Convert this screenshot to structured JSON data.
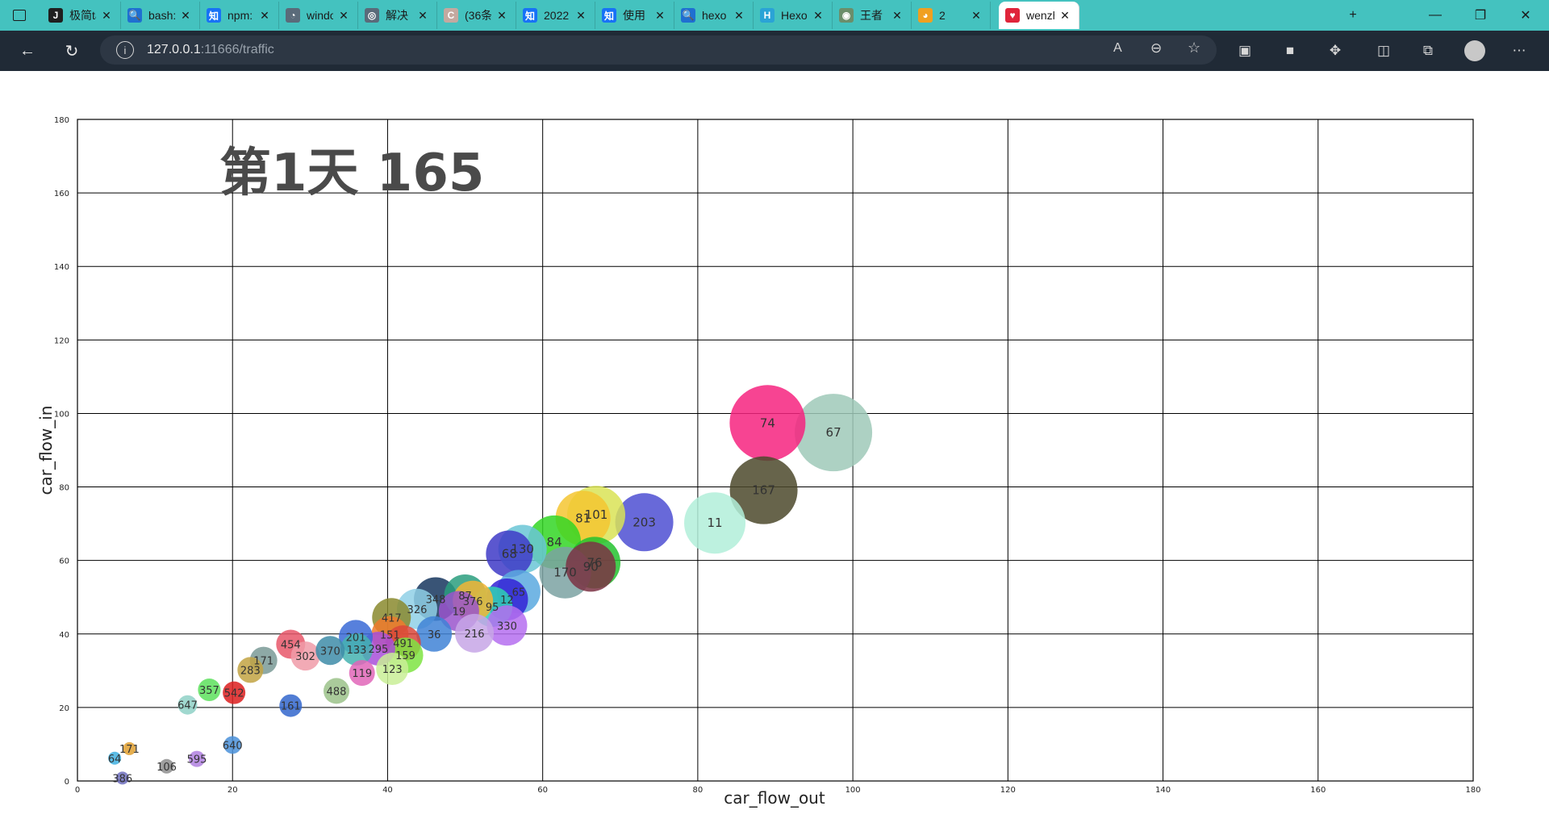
{
  "browser": {
    "tabs": [
      {
        "title": "极简ta",
        "icon": "j-icon",
        "glyph": "J",
        "color": "#1f1f1f",
        "active": false
      },
      {
        "title": "bash:",
        "icon": "search-icon",
        "glyph": "🔍",
        "color": "#1f6fd1",
        "active": false
      },
      {
        "title": "npm:",
        "icon": "zhihu-icon",
        "glyph": "知",
        "color": "#1772f6",
        "active": false
      },
      {
        "title": "windo",
        "icon": "site-icon",
        "glyph": "◔",
        "color": "#5a6b7a",
        "active": false
      },
      {
        "title": "解决 E",
        "icon": "site-icon",
        "glyph": "◎",
        "color": "#5a6b7a",
        "active": false
      },
      {
        "title": "(36条",
        "icon": "csdn-icon",
        "glyph": "C",
        "color": "#c4a9a0",
        "active": false
      },
      {
        "title": "2022",
        "icon": "zhihu-icon",
        "glyph": "知",
        "color": "#1772f6",
        "active": false
      },
      {
        "title": "使用",
        "icon": "zhihu-icon",
        "glyph": "知",
        "color": "#1772f6",
        "active": false
      },
      {
        "title": "hexo",
        "icon": "search-icon",
        "glyph": "🔍",
        "color": "#1f6fd1",
        "active": false
      },
      {
        "title": "Hexo",
        "icon": "hexo-icon",
        "glyph": "H",
        "color": "#2aa3d6",
        "active": false
      },
      {
        "title": "王者",
        "icon": "site-icon",
        "glyph": "◉",
        "color": "#6b8e6b",
        "active": false
      },
      {
        "title": "2",
        "icon": "audio-icon",
        "glyph": "◕",
        "color": "#f0a020",
        "active": false
      },
      {
        "title": "wenzh",
        "icon": "heart-icon",
        "glyph": "♥",
        "color": "#e0243a",
        "active": true
      }
    ],
    "new_tab_label": "+",
    "url_host": "127.0.0.1",
    "url_rest": ":11666/traffic"
  },
  "chart_data": {
    "type": "scatter",
    "title": "第1天 165",
    "xlabel": "car_flow_out",
    "ylabel": "car_flow_in",
    "xlim": [
      0,
      180
    ],
    "ylim": [
      0,
      180
    ],
    "xticks": [
      0,
      20,
      40,
      60,
      80,
      100,
      120,
      140,
      160,
      180
    ],
    "yticks": [
      0,
      20,
      40,
      60,
      80,
      100,
      120,
      140,
      160,
      180
    ],
    "grid": true,
    "points": [
      {
        "label": "67",
        "x": 97.5,
        "y": 94.8,
        "r": 48,
        "color": "#9fc9b9"
      },
      {
        "label": "74",
        "x": 89.0,
        "y": 97.4,
        "r": 47,
        "color": "#f6237f"
      },
      {
        "label": "167",
        "x": 88.5,
        "y": 79.1,
        "r": 42,
        "color": "#4c492b"
      },
      {
        "label": "11",
        "x": 82.2,
        "y": 70.2,
        "r": 38,
        "color": "#b1efd9"
      },
      {
        "label": "203",
        "x": 73.1,
        "y": 70.4,
        "r": 36,
        "color": "#4d4fd2"
      },
      {
        "label": "101",
        "x": 66.9,
        "y": 72.4,
        "r": 36,
        "color": "#d9e356"
      },
      {
        "label": "81",
        "x": 65.2,
        "y": 71.5,
        "r": 34,
        "color": "#f5c531"
      },
      {
        "label": "84",
        "x": 61.5,
        "y": 65.0,
        "r": 33,
        "color": "#33d624"
      },
      {
        "label": "76",
        "x": 66.7,
        "y": 59.4,
        "r": 32,
        "color": "#23c22f"
      },
      {
        "label": "90",
        "x": 66.2,
        "y": 58.3,
        "r": 31,
        "color": "#7b3244"
      },
      {
        "label": "170",
        "x": 62.9,
        "y": 56.7,
        "r": 32,
        "color": "#7ba2a2"
      },
      {
        "label": "130",
        "x": 57.4,
        "y": 63.1,
        "r": 30,
        "color": "#6ac6d6"
      },
      {
        "label": "68",
        "x": 55.7,
        "y": 61.8,
        "r": 29,
        "color": "#3e3ac7"
      },
      {
        "label": "65",
        "x": 56.9,
        "y": 51.5,
        "r": 27,
        "color": "#5aa9df"
      },
      {
        "label": "12",
        "x": 55.4,
        "y": 49.4,
        "r": 26,
        "color": "#3322d6"
      },
      {
        "label": "95",
        "x": 53.5,
        "y": 47.4,
        "r": 25,
        "color": "#2fd1b4"
      },
      {
        "label": "330",
        "x": 55.4,
        "y": 42.3,
        "r": 25,
        "color": "#b56ef0"
      },
      {
        "label": "216",
        "x": 51.2,
        "y": 40.2,
        "r": 24,
        "color": "#c7a6e6"
      },
      {
        "label": "376",
        "x": 51.0,
        "y": 49.0,
        "r": 25,
        "color": "#f2b535"
      },
      {
        "label": "87",
        "x": 50.0,
        "y": 50.5,
        "r": 26,
        "color": "#2a9e7e"
      },
      {
        "label": "19",
        "x": 49.2,
        "y": 46.2,
        "r": 25,
        "color": "#9a55cc"
      },
      {
        "label": "348",
        "x": 46.2,
        "y": 49.5,
        "r": 27,
        "color": "#16365e"
      },
      {
        "label": "36",
        "x": 46.0,
        "y": 40.0,
        "r": 22,
        "color": "#3f83d6"
      },
      {
        "label": "326",
        "x": 43.8,
        "y": 46.8,
        "r": 25,
        "color": "#8fd0e6"
      },
      {
        "label": "417",
        "x": 40.5,
        "y": 44.5,
        "r": 24,
        "color": "#8a8a2e"
      },
      {
        "label": "151",
        "x": 40.3,
        "y": 39.8,
        "r": 23,
        "color": "#ee7a2d"
      },
      {
        "label": "491",
        "x": 42.0,
        "y": 37.5,
        "r": 22,
        "color": "#d9463a"
      },
      {
        "label": "159",
        "x": 42.3,
        "y": 34.2,
        "r": 22,
        "color": "#7ee442"
      },
      {
        "label": "123",
        "x": 40.6,
        "y": 30.5,
        "r": 20,
        "color": "#c9ef96"
      },
      {
        "label": "295",
        "x": 38.8,
        "y": 36.0,
        "r": 21,
        "color": "#a84fd9"
      },
      {
        "label": "201",
        "x": 35.9,
        "y": 39.2,
        "r": 21,
        "color": "#3a6ad6"
      },
      {
        "label": "133",
        "x": 36.0,
        "y": 35.8,
        "r": 20,
        "color": "#45b3b0"
      },
      {
        "label": "454",
        "x": 27.5,
        "y": 37.2,
        "r": 18,
        "color": "#e8576a"
      },
      {
        "label": "302",
        "x": 29.4,
        "y": 34.0,
        "r": 18,
        "color": "#f09ba8"
      },
      {
        "label": "370",
        "x": 32.6,
        "y": 35.5,
        "r": 18,
        "color": "#3e8ca8"
      },
      {
        "label": "171",
        "x": 24.0,
        "y": 32.8,
        "r": 17,
        "color": "#7a9a96"
      },
      {
        "label": "283",
        "x": 22.3,
        "y": 30.2,
        "r": 16,
        "color": "#c2a343"
      },
      {
        "label": "119",
        "x": 36.7,
        "y": 29.4,
        "r": 16,
        "color": "#e066b9"
      },
      {
        "label": "488",
        "x": 33.4,
        "y": 24.5,
        "r": 16,
        "color": "#9bc28a"
      },
      {
        "label": "357",
        "x": 17.0,
        "y": 24.8,
        "r": 14,
        "color": "#5de05d"
      },
      {
        "label": "542",
        "x": 20.2,
        "y": 24.0,
        "r": 14,
        "color": "#dc1e1e"
      },
      {
        "label": "647",
        "x": 14.2,
        "y": 20.7,
        "r": 12,
        "color": "#8fd1c7"
      },
      {
        "label": "161",
        "x": 27.5,
        "y": 20.5,
        "r": 14,
        "color": "#3366cc"
      },
      {
        "label": "640",
        "x": 20.0,
        "y": 9.8,
        "r": 11,
        "color": "#4a90d9"
      },
      {
        "label": "595",
        "x": 15.4,
        "y": 6.0,
        "r": 10,
        "color": "#b080e0"
      },
      {
        "label": "106",
        "x": 11.5,
        "y": 4.0,
        "r": 9,
        "color": "#8e8e8e"
      },
      {
        "label": "171",
        "x": 6.7,
        "y": 8.8,
        "r": 8,
        "color": "#e0a030"
      },
      {
        "label": "64",
        "x": 4.8,
        "y": 6.2,
        "r": 8,
        "color": "#40b0e0"
      },
      {
        "label": "386",
        "x": 5.8,
        "y": 0.8,
        "r": 8,
        "color": "#7070c0"
      }
    ]
  }
}
